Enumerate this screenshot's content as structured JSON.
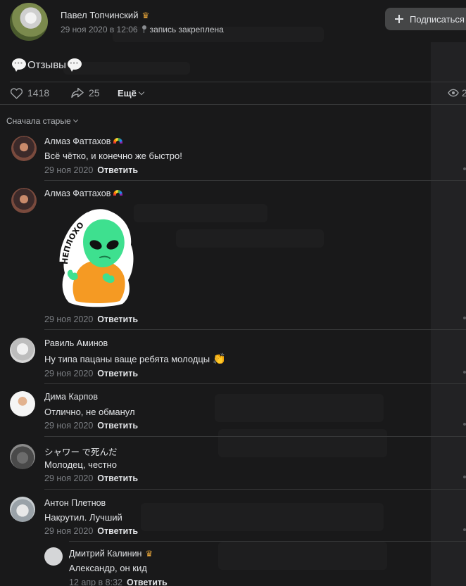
{
  "post": {
    "author": "Павел Топчинский",
    "date": "29 ноя 2020 в 12:06",
    "pinned_label": "запись закреплена",
    "subscribe_label": "Подписаться",
    "text": "Отзывы",
    "likes": "1418",
    "shares": "25",
    "more_label": "Ещё",
    "views_partial": "2"
  },
  "sort_label": "Сначала старые",
  "sticker_text": "НЕПЛОХО",
  "comments": [
    {
      "name": "Алмаз Фаттахов",
      "text": "Всё чётко, и конечно же быстро!",
      "date": "29 ноя 2020",
      "reply": "Ответить"
    },
    {
      "name": "Алмаз Фаттахов",
      "text": "",
      "date": "29 ноя 2020",
      "reply": "Ответить"
    },
    {
      "name": "Равиль Аминов",
      "text": "Ну типа пацаны ваще ребята молодцы",
      "date": "29 ноя 2020",
      "reply": "Ответить"
    },
    {
      "name": "Дима Карпов",
      "text": "Отлично, не обманул",
      "date": "29 ноя 2020",
      "reply": "Ответить"
    },
    {
      "name": "シャワー で死んだ",
      "text": "Молодец, честно",
      "date": "29 ноя 2020",
      "reply": "Ответить"
    },
    {
      "name": "Антон Плетнов",
      "text": "Накрутил. Лучший",
      "date": "29 ноя 2020",
      "reply": "Ответить"
    },
    {
      "name": "Дмитрий Калинин",
      "text": "Александр, он кид",
      "date": "12 апр в 8:32",
      "reply": "Ответить"
    }
  ],
  "colors": {
    "background": "#19191a",
    "divider": "#363738",
    "muted": "#7d8085",
    "crown": "#e8a63a"
  },
  "icons": [
    "plus-icon",
    "crown-icon",
    "pin-icon",
    "speech-bubble-icon",
    "heart-icon",
    "share-icon",
    "chevron-down-icon",
    "eye-icon",
    "rainbow-icon",
    "clap-icon"
  ]
}
